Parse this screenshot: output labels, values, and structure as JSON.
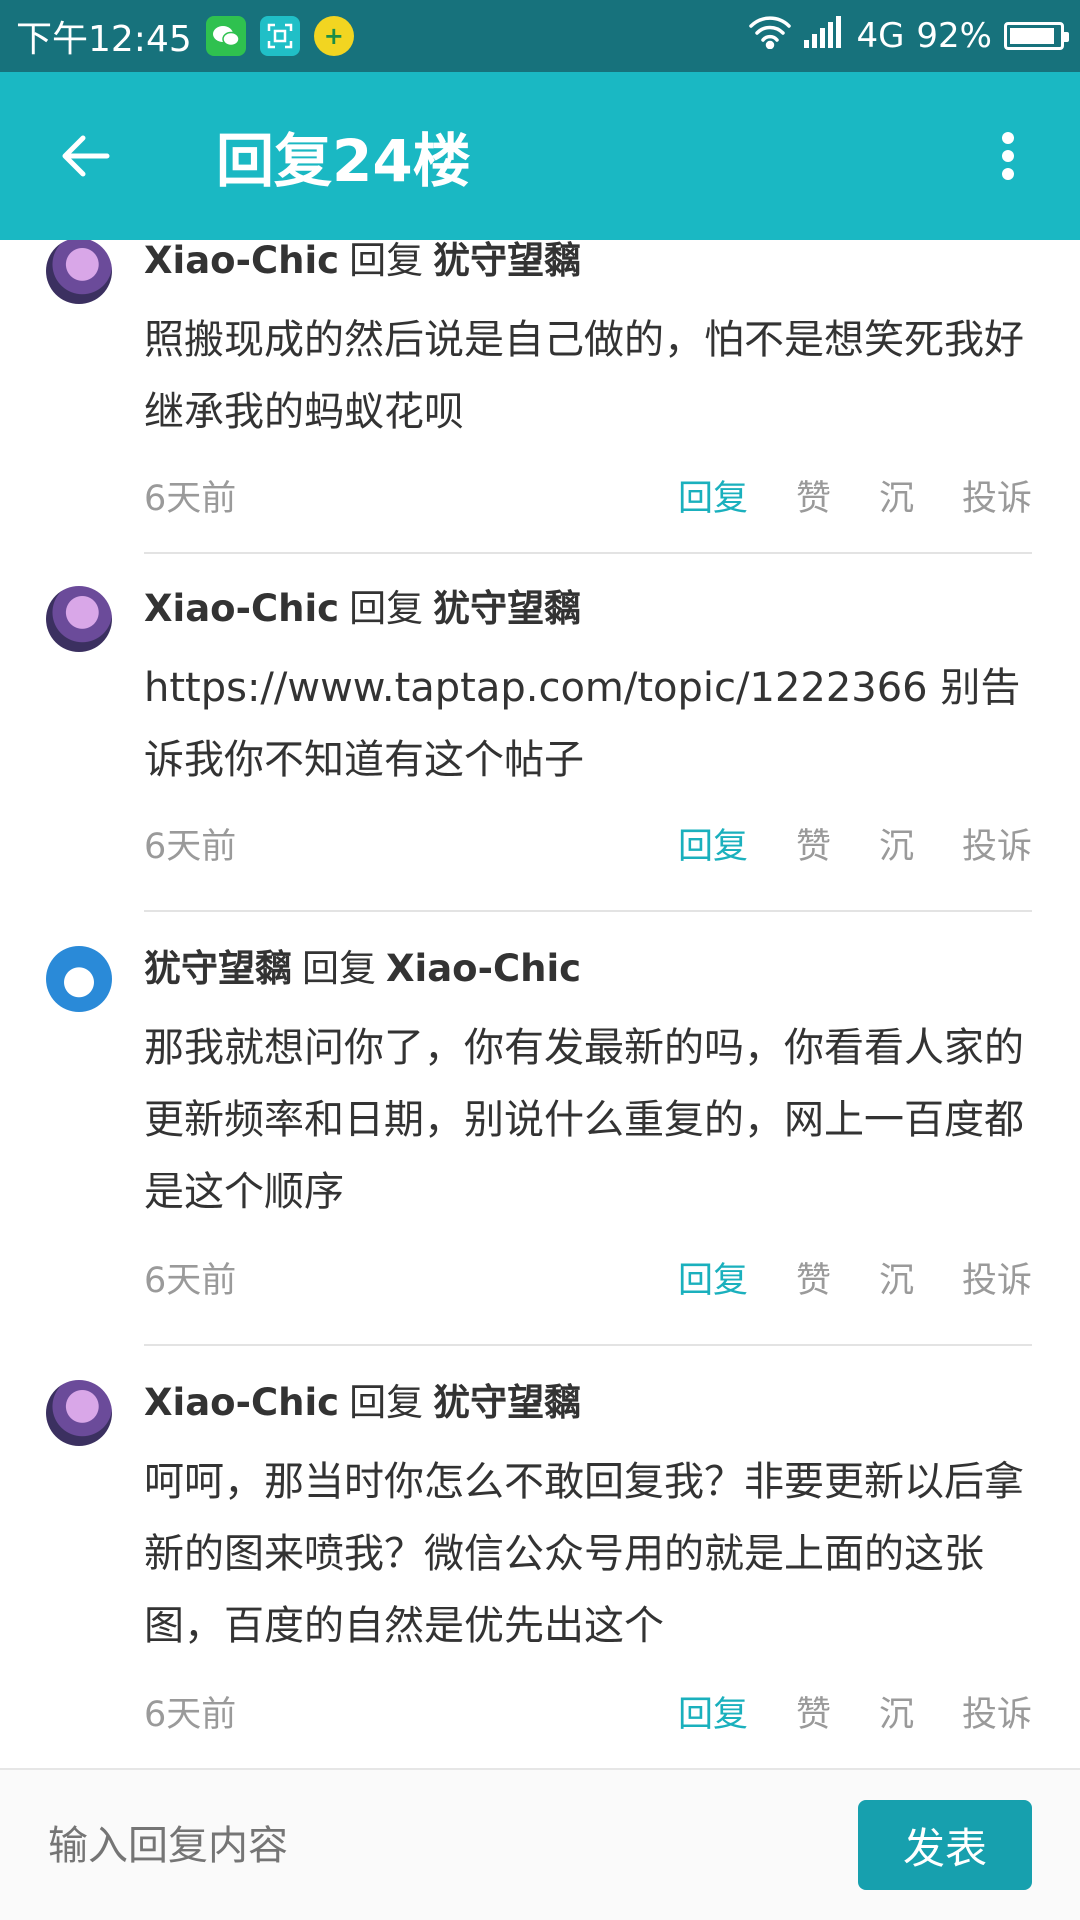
{
  "status_bar": {
    "time": "下午12:45",
    "network": "4G",
    "battery_text": "92%",
    "battery_level": 0.92
  },
  "app_bar": {
    "title": "回复24楼"
  },
  "comments": [
    {
      "author": "Xiao-Chic",
      "reply_word": "回复",
      "target": "犹守望黐",
      "body": "照搬现成的然后说是自己做的，怕不是想笑死我好继承我的蚂蚁花呗",
      "time": "6天前"
    },
    {
      "author": "Xiao-Chic",
      "reply_word": "回复",
      "target": "犹守望黐",
      "body": "https://www.taptap.com/topic/1222366 别告诉我你不知道有这个帖子",
      "time": "6天前"
    },
    {
      "author": "犹守望黐",
      "reply_word": "回复",
      "target": "Xiao-Chic",
      "body": "那我就想问你了，你有发最新的吗，你看看人家的更新频率和日期，别说什么重复的，网上一百度都是这个顺序",
      "time": "6天前"
    },
    {
      "author": "Xiao-Chic",
      "reply_word": "回复",
      "target": "犹守望黐",
      "body": "呵呵，那当时你怎么不敢回复我？非要更新以后拿新的图来喷我？微信公众号用的就是上面的这张图，百度的自然是优先出这个",
      "time": "6天前"
    }
  ],
  "actions": {
    "reply": "回复",
    "like": "赞",
    "sink": "沉",
    "report": "投诉"
  },
  "reply_bar": {
    "placeholder": "输入回复内容",
    "submit": "发表"
  }
}
